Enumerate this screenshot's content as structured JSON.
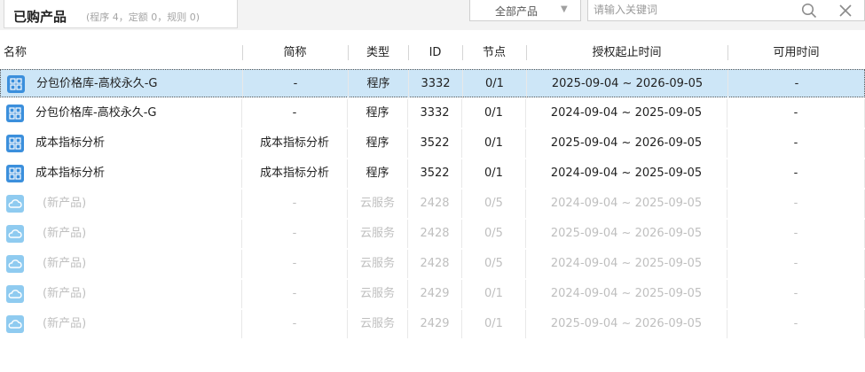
{
  "panel": {
    "title": "已购产品",
    "subtitle": "(程序 4，定额 0，规则 0)"
  },
  "filter": {
    "selected": "全部产品"
  },
  "search": {
    "placeholder": "请输入关键词"
  },
  "columns": [
    "名称",
    "简称",
    "类型",
    "ID",
    "节点",
    "授权起止时间",
    "可用时间"
  ],
  "rows": [
    {
      "name": "分包价格库-高校永久-G",
      "short": "-",
      "type": "程序",
      "id": "3332",
      "node": "0/1",
      "period": "2025-09-04 ~ 2026-09-05",
      "avail": "-",
      "icon": "app-grid-icon",
      "dim": false,
      "selected": true
    },
    {
      "name": "分包价格库-高校永久-G",
      "short": "-",
      "type": "程序",
      "id": "3332",
      "node": "0/1",
      "period": "2024-09-04 ~ 2025-09-05",
      "avail": "-",
      "icon": "app-grid-icon",
      "dim": false,
      "selected": false
    },
    {
      "name": "成本指标分析",
      "short": "成本指标分析",
      "type": "程序",
      "id": "3522",
      "node": "0/1",
      "period": "2025-09-04 ~ 2026-09-05",
      "avail": "-",
      "icon": "app-grid-icon",
      "dim": false,
      "selected": false
    },
    {
      "name": "成本指标分析",
      "short": "成本指标分析",
      "type": "程序",
      "id": "3522",
      "node": "0/1",
      "period": "2024-09-04 ~ 2025-09-05",
      "avail": "-",
      "icon": "app-grid-icon",
      "dim": false,
      "selected": false
    },
    {
      "name": "(新产品)",
      "short": "-",
      "type": "云服务",
      "id": "2428",
      "node": "0/5",
      "period": "2024-09-04 ~ 2025-09-05",
      "avail": "-",
      "icon": "cloud-icon",
      "dim": true,
      "selected": false
    },
    {
      "name": "(新产品)",
      "short": "-",
      "type": "云服务",
      "id": "2428",
      "node": "0/5",
      "period": "2025-09-04 ~ 2026-09-05",
      "avail": "-",
      "icon": "cloud-icon",
      "dim": true,
      "selected": false
    },
    {
      "name": "(新产品)",
      "short": "-",
      "type": "云服务",
      "id": "2428",
      "node": "0/5",
      "period": "2024-09-04 ~ 2025-09-05",
      "avail": "-",
      "icon": "cloud-icon",
      "dim": true,
      "selected": false
    },
    {
      "name": "(新产品)",
      "short": "-",
      "type": "云服务",
      "id": "2429",
      "node": "0/1",
      "period": "2024-09-04 ~ 2025-09-05",
      "avail": "-",
      "icon": "cloud-icon",
      "dim": true,
      "selected": false
    },
    {
      "name": "(新产品)",
      "short": "-",
      "type": "云服务",
      "id": "2429",
      "node": "0/1",
      "period": "2025-09-04 ~ 2026-09-05",
      "avail": "-",
      "icon": "cloud-icon",
      "dim": true,
      "selected": false
    }
  ],
  "colors": {
    "accent": "#2f8fe0",
    "selected_row": "#cde6f7",
    "cloud_icon": "#8fcbf0"
  }
}
